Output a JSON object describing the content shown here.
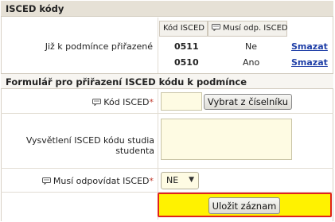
{
  "section": {
    "title": "ISCED kódy"
  },
  "assigned": {
    "label": "Již k podmínce přiřazené",
    "columns": {
      "code": "Kód ISCED",
      "must": "Musí odp. ISCED"
    },
    "rows": [
      {
        "code": "0511",
        "must": "Ne",
        "action": "Smazat"
      },
      {
        "code": "0510",
        "must": "Ano",
        "action": "Smazat"
      }
    ]
  },
  "form": {
    "title": "Formulář pro přiřazení ISCED kódu k podmínce",
    "code_label": "Kód ISCED",
    "code_value": "",
    "catalog_button": "Vybrat z číselníku",
    "explain_label": "Vysvětlení ISCED kódu studia studenta",
    "explain_value": "",
    "must_label": "Musí odpovídat ISCED",
    "must_value": "NE",
    "required_mark": "*",
    "save_button": "Uložit záznam"
  }
}
